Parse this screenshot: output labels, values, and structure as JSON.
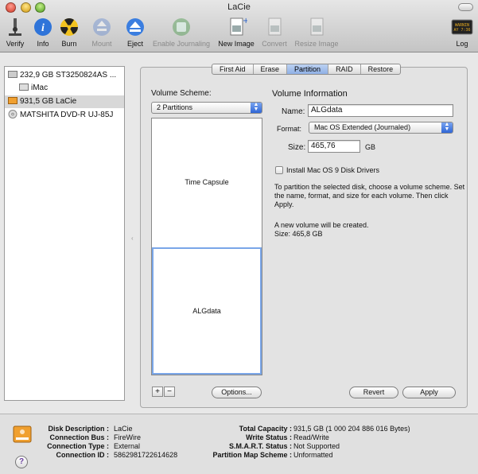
{
  "window": {
    "title": "LaCie"
  },
  "toolbar": {
    "items": [
      {
        "label": "Verify",
        "icon": "microscope-icon",
        "enabled": true
      },
      {
        "label": "Info",
        "icon": "info-icon",
        "enabled": true
      },
      {
        "label": "Burn",
        "icon": "burn-icon",
        "enabled": true
      },
      {
        "label": "Mount",
        "icon": "mount-icon",
        "enabled": false
      },
      {
        "label": "Eject",
        "icon": "eject-icon",
        "enabled": true
      },
      {
        "label": "Enable Journaling",
        "icon": "journaling-icon",
        "enabled": false
      },
      {
        "label": "New Image",
        "icon": "new-image-icon",
        "enabled": true
      },
      {
        "label": "Convert",
        "icon": "convert-icon",
        "enabled": false
      },
      {
        "label": "Resize Image",
        "icon": "resize-image-icon",
        "enabled": false
      },
      {
        "label": "Log",
        "icon": "log-icon",
        "enabled": true
      }
    ],
    "log_text": "WARNIN\nAY 7:36"
  },
  "sidebar": {
    "items": [
      {
        "label": "232,9 GB ST3250824AS ...",
        "type": "disk"
      },
      {
        "label": "iMac",
        "type": "volume"
      },
      {
        "label": "931,5 GB LaCie",
        "type": "disk",
        "selected": true
      },
      {
        "label": "MATSHITA DVD-R UJ-85J",
        "type": "optical"
      }
    ]
  },
  "tabs": [
    {
      "label": "First Aid",
      "active": false
    },
    {
      "label": "Erase",
      "active": false
    },
    {
      "label": "Partition",
      "active": true
    },
    {
      "label": "RAID",
      "active": false
    },
    {
      "label": "Restore",
      "active": false
    }
  ],
  "partition": {
    "scheme_heading": "Volume Scheme:",
    "scheme_value": "2 Partitions",
    "parts": [
      {
        "name": "Time Capsule",
        "size_fraction": 0.5
      },
      {
        "name": "ALGdata",
        "size_fraction": 0.5,
        "selected": true
      }
    ],
    "info_heading": "Volume Information",
    "name_label": "Name:",
    "name_value": "ALGdata",
    "format_label": "Format:",
    "format_value": "Mac OS Extended (Journaled)",
    "size_label": "Size:",
    "size_value": "465,76",
    "size_unit": "GB",
    "checkbox_label": "Install Mac OS 9 Disk Drivers",
    "instructions": "To partition the selected disk, choose a volume scheme. Set the name, format, and size for each volume. Then click Apply.",
    "status_line1": "A new volume will be created.",
    "status_line2": "Size: 465,8 GB",
    "plus": "+",
    "minus": "−",
    "options_button": "Options...",
    "revert_button": "Revert",
    "apply_button": "Apply"
  },
  "footer": {
    "left": [
      {
        "key": "Disk Description :",
        "value": "LaCie"
      },
      {
        "key": "Connection Bus :",
        "value": "FireWire"
      },
      {
        "key": "Connection Type :",
        "value": "External"
      },
      {
        "key": "Connection ID :",
        "value": "5862981722614628"
      }
    ],
    "right": [
      {
        "key": "Total Capacity :",
        "value": "931,5 GB (1 000 204 886 016 Bytes)"
      },
      {
        "key": "Write Status :",
        "value": "Read/Write"
      },
      {
        "key": "S.M.A.R.T. Status :",
        "value": "Not Supported"
      },
      {
        "key": "Partition Map Scheme :",
        "value": "Unformatted"
      }
    ],
    "help": "?"
  },
  "colors": {
    "selection": "#d8d8d8",
    "accent": "#3a6fd8",
    "tab_active": "#a9c3ee"
  }
}
